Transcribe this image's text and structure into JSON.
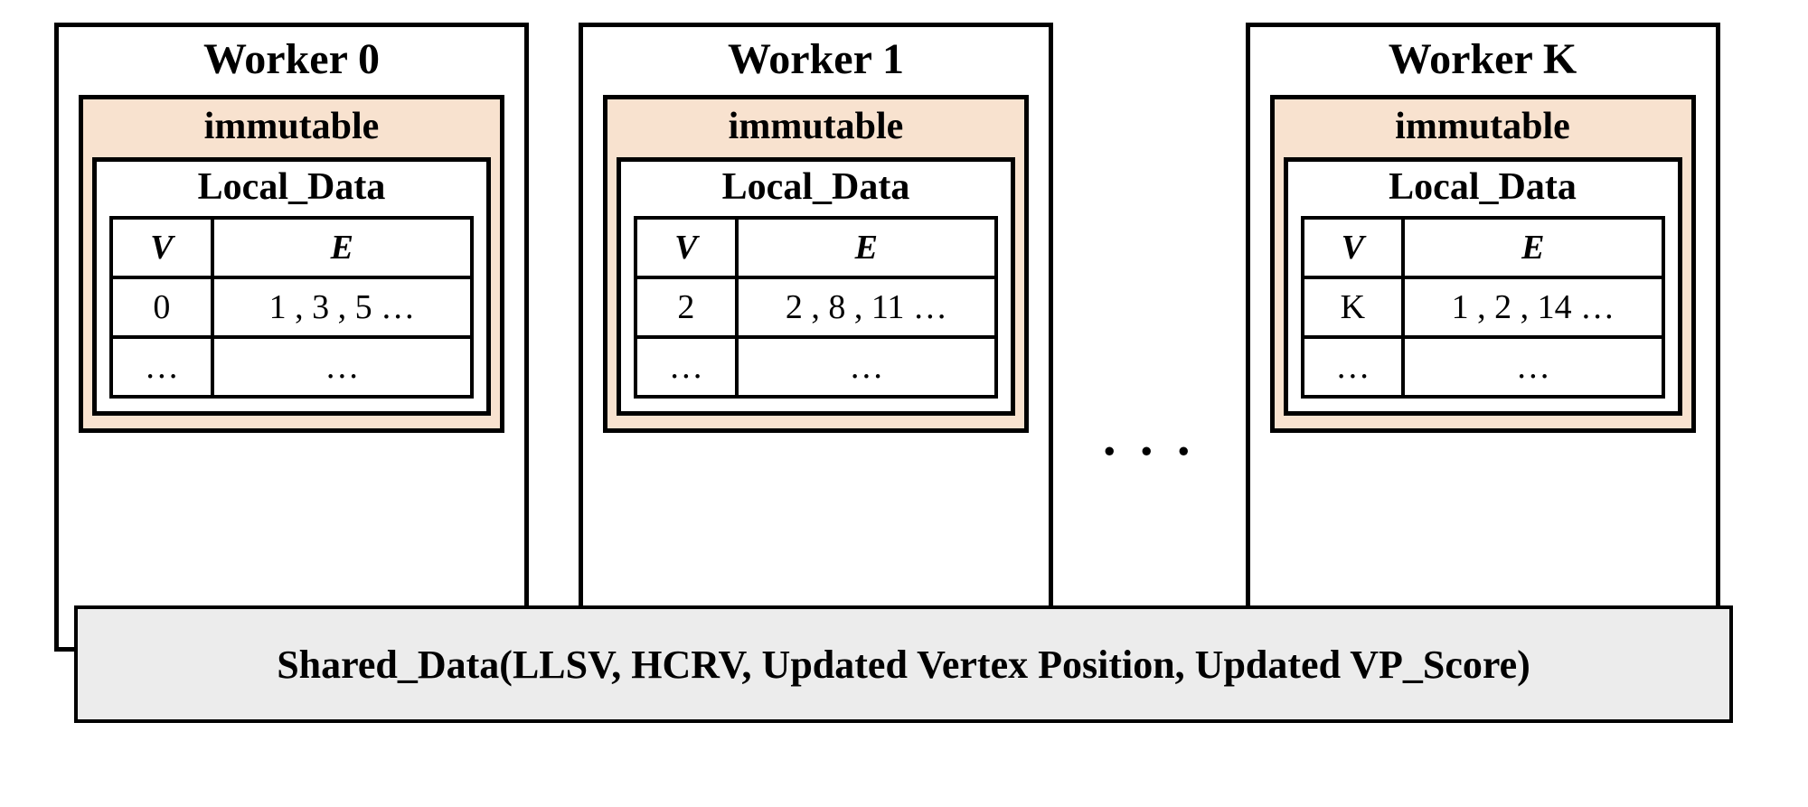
{
  "workers": [
    {
      "title": "Worker 0",
      "immutable_label": "immutable",
      "localdata_label": "Local_Data",
      "headers": {
        "v": "V",
        "e": "E"
      },
      "rows": [
        {
          "v": "0",
          "e": "1 , 3 , 5 …"
        },
        {
          "v": "…",
          "e": "…"
        }
      ]
    },
    {
      "title": "Worker 1",
      "immutable_label": "immutable",
      "localdata_label": "Local_Data",
      "headers": {
        "v": "V",
        "e": "E"
      },
      "rows": [
        {
          "v": "2",
          "e": "2 , 8 , 11 …"
        },
        {
          "v": "…",
          "e": "…"
        }
      ]
    },
    {
      "title": "Worker K",
      "immutable_label": "immutable",
      "localdata_label": "Local_Data",
      "headers": {
        "v": "V",
        "e": "E"
      },
      "rows": [
        {
          "v": "K",
          "e": "1 , 2 , 14 …"
        },
        {
          "v": "…",
          "e": "…"
        }
      ]
    }
  ],
  "ellipsis": ". . .",
  "shared_label": "Shared_Data(LLSV, HCRV, Updated Vertex Position, Updated VP_Score)"
}
